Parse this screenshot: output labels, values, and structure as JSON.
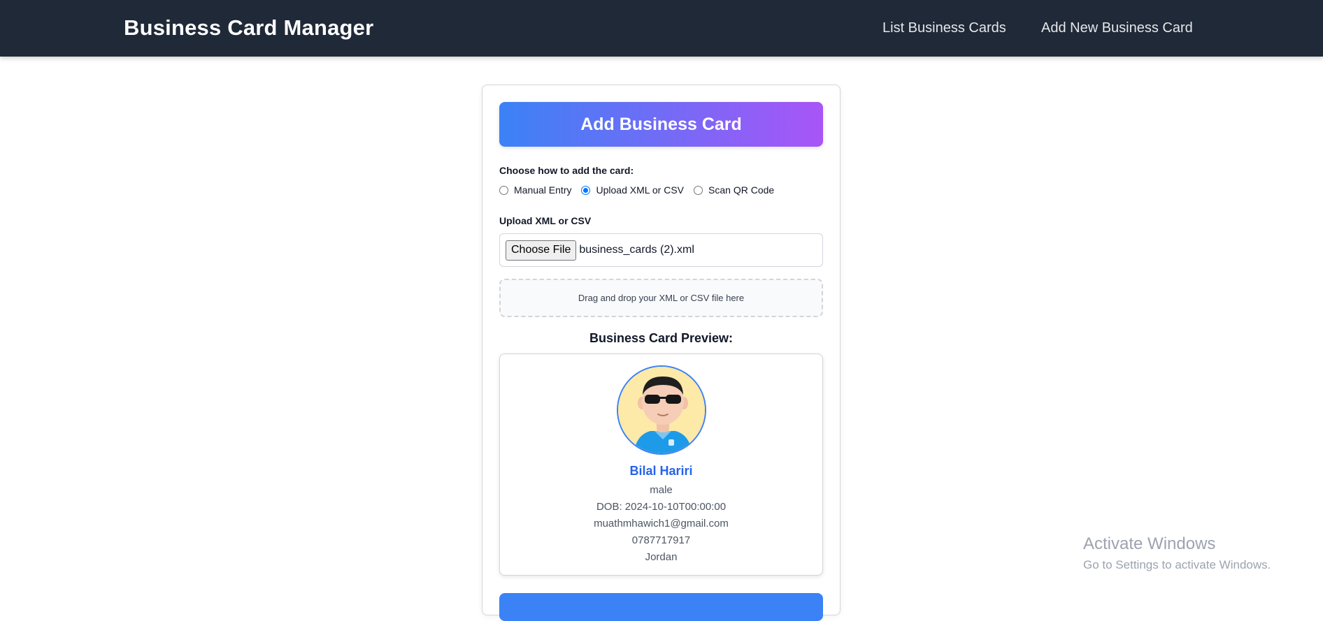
{
  "nav": {
    "brand": "Business Card Manager",
    "links": [
      "List Business Cards",
      "Add New Business Card"
    ]
  },
  "form": {
    "header": "Add Business Card",
    "choose_label": "Choose how to add the card:",
    "options": [
      {
        "label": "Manual Entry",
        "checked": false
      },
      {
        "label": "Upload XML or CSV",
        "checked": true
      },
      {
        "label": "Scan QR Code",
        "checked": false
      }
    ],
    "upload_label": "Upload XML or CSV",
    "file_button": "Choose File",
    "file_name": "business_cards (2).xml",
    "dropzone_text": "Drag and drop your XML or CSV file here"
  },
  "preview": {
    "title": "Business Card Preview:",
    "name": "Bilal Hariri",
    "gender": "male",
    "dob": "DOB: 2024-10-10T00:00:00",
    "email": "muathmhawich1@gmail.com",
    "phone": "0787717917",
    "country": "Jordan"
  },
  "watermark": {
    "title": "Activate Windows",
    "subtitle": "Go to Settings to activate Windows."
  },
  "colors": {
    "navbar": "#1f2937",
    "gradient_start": "#3b82f6",
    "gradient_end": "#a855f7",
    "accent": "#2563eb"
  }
}
